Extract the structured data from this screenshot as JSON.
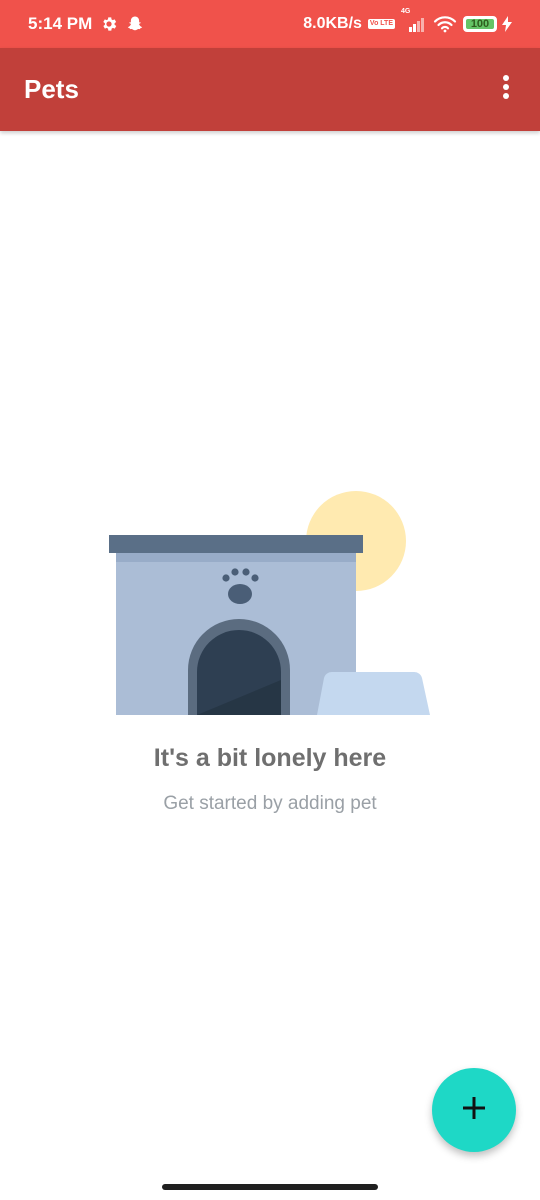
{
  "status_bar": {
    "time": "5:14 PM",
    "network_speed": "8.0KB/s",
    "volte_badge": "Vo LTE",
    "network_type": "4G",
    "battery_level": "100",
    "battery_fraction": 1.0,
    "icons": [
      "settings-icon",
      "snapchat-icon",
      "volte-icon",
      "signal-icon",
      "wifi-icon",
      "battery-icon",
      "charging-icon"
    ]
  },
  "app_bar": {
    "title": "Pets",
    "overflow_icon": "more-vertical-icon"
  },
  "empty_state": {
    "title": "It's a bit lonely here",
    "subtitle": "Get started by adding pet",
    "illustration": "dog-house-illustration"
  },
  "fab": {
    "icon": "plus-icon"
  },
  "colors": {
    "status_bar": "#f0524b",
    "app_bar": "#c1403a",
    "fab": "#1ed8c6",
    "title_text": "#6f6f6f",
    "subtitle_text": "#9aa0a6"
  }
}
